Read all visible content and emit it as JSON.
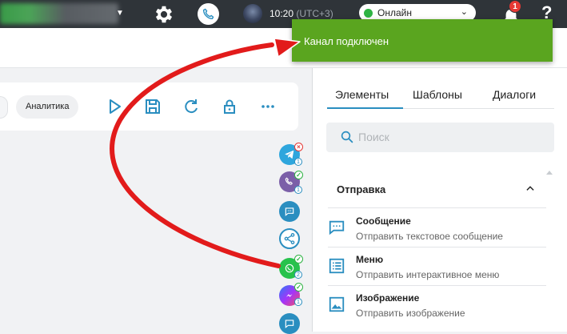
{
  "topbar": {
    "time": "10:20",
    "timezone": "(UTC+3)",
    "status_label": "Онлайн",
    "notifications_count": "1",
    "help_label": "?"
  },
  "toast": {
    "message": "Канал подключен",
    "color": "#5aa51f"
  },
  "toolbar": {
    "analytics_label": "Аналитика"
  },
  "channels": [
    {
      "name": "telegram",
      "count": "1",
      "status": "error"
    },
    {
      "name": "viber",
      "count": "1",
      "status": "ok"
    },
    {
      "name": "chat",
      "count": "",
      "status": ""
    },
    {
      "name": "share",
      "count": "",
      "status": ""
    },
    {
      "name": "whatsapp",
      "count": "2",
      "status": "ok"
    },
    {
      "name": "messenger",
      "count": "1",
      "status": "ok"
    },
    {
      "name": "chat-bubble",
      "count": "",
      "status": ""
    }
  ],
  "panel": {
    "tabs": [
      "Элементы",
      "Шаблоны",
      "Диалоги"
    ],
    "search_placeholder": "Поиск",
    "section_title": "Отправка",
    "items": [
      {
        "title": "Сообщение",
        "subtitle": "Отправить текстовое сообщение",
        "icon": "message-icon"
      },
      {
        "title": "Меню",
        "subtitle": "Отправить интерактивное меню",
        "icon": "menu-list-icon"
      },
      {
        "title": "Изображение",
        "subtitle": "Отправить изображение",
        "icon": "image-icon"
      }
    ]
  },
  "colors": {
    "accent": "#2a8ec0",
    "topbar": "#2f3439",
    "online": "#2fb344",
    "badge": "#e53935",
    "arrow": "#e21b1b"
  }
}
